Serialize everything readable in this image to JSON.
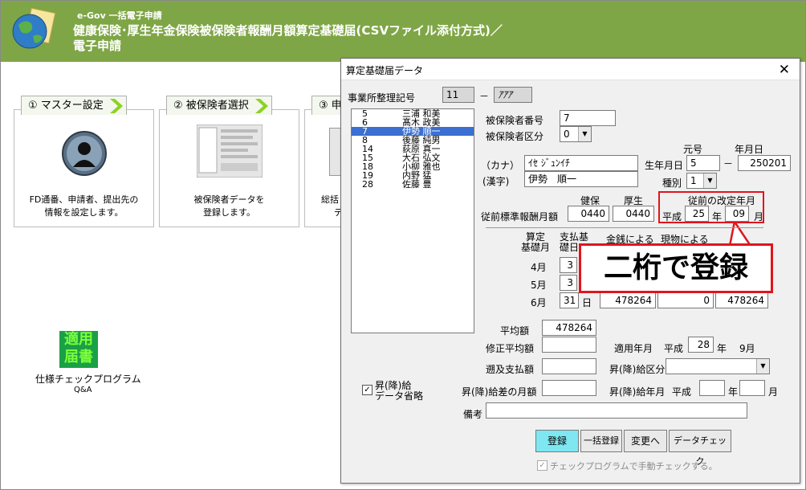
{
  "header": {
    "app_name": "e-Gov 一括電子申請",
    "title_line1": "健康保険･厚生年金保険被保険者報酬月額算定基礎届(CSVファイル添付方式)／",
    "title_line2": "電子申請"
  },
  "cards": [
    {
      "tab": "① マスター設定",
      "desc1": "FD通番、申請者、提出先の",
      "desc2": "情報を設定します。"
    },
    {
      "tab": "② 被保険者選択",
      "desc1": "被保険者データを",
      "desc2": "登録します。"
    },
    {
      "tab": "③ 申",
      "desc1": "総括",
      "desc2": "デ"
    }
  ],
  "check_program": {
    "badge_line1": "適用",
    "badge_line2": "届書",
    "label": "仕様チェックプログラム",
    "sub": "Q&A"
  },
  "dialog": {
    "title": "算定基礎届データ",
    "close": "✕",
    "office_label": "事業所整理記号",
    "office_code1": "11",
    "office_dash": "－",
    "office_code2": "ｱｱｱ",
    "employees": [
      {
        "no": "5",
        "name": "三浦 和美"
      },
      {
        "no": "6",
        "name": "髙木 政美"
      },
      {
        "no": "7",
        "name": "伊勢 順一"
      },
      {
        "no": "8",
        "name": "後藤 純男"
      },
      {
        "no": "14",
        "name": "荻原 真一"
      },
      {
        "no": "15",
        "name": "大石 弘文"
      },
      {
        "no": "18",
        "name": "小柳 雅也"
      },
      {
        "no": "19",
        "name": "内野 猛"
      },
      {
        "no": "28",
        "name": "佐藤 豊"
      }
    ],
    "insured_no_label": "被保険者番号",
    "insured_no": "7",
    "insured_type_label": "被保険者区分",
    "insured_type": "0",
    "kana_label": "（カナ）",
    "kana": "ｲｾ ｼﾞｭﾝｲﾁ",
    "kanji_label": "(漢字)",
    "kanji": "伊勢　順一",
    "era_label": "元号",
    "ymd_label": "年月日",
    "birth_label": "生年月日",
    "birth_era": "5",
    "birth_dash": "－",
    "birth_date": "250201",
    "kind_label": "種別",
    "kind": "1",
    "health_label": "健保",
    "pension_label": "厚生",
    "std_pay_label": "従前標準報酬月額",
    "health_amt": "0440",
    "pension_amt": "0440",
    "prev_rev_label": "従前の改定年月",
    "prev_era": "平成",
    "prev_year": "25",
    "year_unit": "年",
    "prev_month": "09",
    "month_unit": "月",
    "calc_month_label1": "算定",
    "calc_month_label2": "基礎月",
    "pay_days_label1": "支払基",
    "pay_days_label2": "礎日",
    "cash_label": "金銭による",
    "kind_pay_label": "現物による",
    "rows": [
      {
        "month": "4月",
        "days": "3"
      },
      {
        "month": "5月",
        "days": "3"
      },
      {
        "month": "6月",
        "days": "31",
        "day_unit": "日",
        "cash": "478264",
        "kind": "0",
        "total": "478264"
      }
    ],
    "callout": "二桁で登録",
    "avg_label": "平均額",
    "avg": "478264",
    "rev_avg_label": "修正平均額",
    "apply_label": "適用年月",
    "apply_era": "平成",
    "apply_year": "28",
    "apply_month": "9月",
    "retro_label": "遡及支払額",
    "raise_type_label": "昇(降)給区分",
    "raise_omit_label1": "昇(降)給",
    "raise_omit_label2": "データ省略",
    "raise_diff_label": "昇(降)給差の月額",
    "raise_month_label": "昇(降)給年月",
    "raise_era": "平成",
    "notes_label": "備考",
    "buttons": {
      "register": "登録",
      "bulk": "一括登録",
      "change": "変更へ",
      "check": "データチェック"
    },
    "manual_check": "チェックプログラムで手動チェックする。"
  }
}
